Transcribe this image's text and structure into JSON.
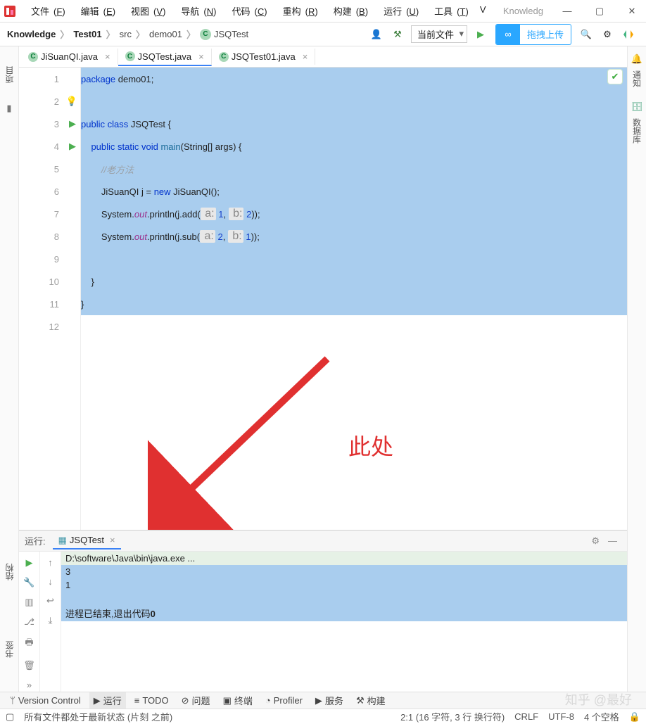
{
  "menu": {
    "file": "文件",
    "edit": "编辑",
    "view": "视图",
    "nav": "导航",
    "code": "代码",
    "refactor": "重构",
    "build": "构建",
    "run": "运行",
    "tools": "工具",
    "v": "V",
    "file_k": "F",
    "edit_k": "E",
    "view_k": "V",
    "nav_k": "N",
    "code_k": "C",
    "refactor_k": "R",
    "build_k": "B",
    "run_k": "U",
    "tools_k": "T"
  },
  "title_hint": "Knowledg",
  "crumbs": {
    "c0": "Knowledge",
    "c1": "Test01",
    "c2": "src",
    "c3": "demo01",
    "c4": "JSQTest"
  },
  "run_combo": "当前文件",
  "upload_label": "拖拽上传",
  "tabs": {
    "t0": "JiSuanQI.java",
    "t1": "JSQTest.java",
    "t2": "JSQTest01.java"
  },
  "side": {
    "project": "项目",
    "structure": "结构",
    "bookmark": "书签",
    "notify": "通知",
    "db": "数据库"
  },
  "gutter": {
    "l1": "1",
    "l2": "2",
    "l3": "3",
    "l4": "4",
    "l5": "5",
    "l6": "6",
    "l7": "7",
    "l8": "8",
    "l9": "9",
    "l10": "10",
    "l11": "11",
    "l12": "12"
  },
  "code": {
    "l1a": "package",
    "l1b": " demo01;",
    "l3a": "public",
    "l3b": " class",
    "l3c": " JSQTest {",
    "l4a": "    public",
    "l4b": " static",
    "l4c": " void",
    "l4d": " main",
    "l4e": "(String[] args) {",
    "l5": "        //老方法",
    "l6a": "        JiSuanQI j = ",
    "l6b": "new",
    "l6c": " JiSuanQI();",
    "l7a": "        System.",
    "l7b": "out",
    "l7c": ".println(j.add(",
    "l7h1": " a:",
    "l7n1": " 1",
    "l7m": ", ",
    "l7h2": " b:",
    "l7n2": " 2",
    "l7d": "));",
    "l8a": "        System.",
    "l8b": "out",
    "l8c": ".println(j.sub(",
    "l8h1": " a:",
    "l8n1": " 2",
    "l8m": ", ",
    "l8h2": " b:",
    "l8n2": " 1",
    "l8d": "));",
    "l10": "    }",
    "l11": "}"
  },
  "annotation": "此处",
  "run": {
    "label": "运行:",
    "tab": "JSQTest",
    "cmd": "D:\\software\\Java\\bin\\java.exe ...",
    "o1": "3",
    "o2": "1",
    "exit_a": "进程已结束,退出代码",
    "exit_b": "0"
  },
  "bottom": {
    "vc": "Version Control",
    "run": "运行",
    "todo": "TODO",
    "problems": "问题",
    "terminal": "终端",
    "profiler": "Profiler",
    "services": "服务",
    "build": "构建"
  },
  "watermark": "知乎 @最好",
  "status": {
    "msg": "所有文件都处于最新状态 (片刻 之前)",
    "pos": "2:1 (16 字符, 3 行 换行符)",
    "crlf": "CRLF",
    "enc": "UTF-8",
    "indent": "4 个空格"
  }
}
